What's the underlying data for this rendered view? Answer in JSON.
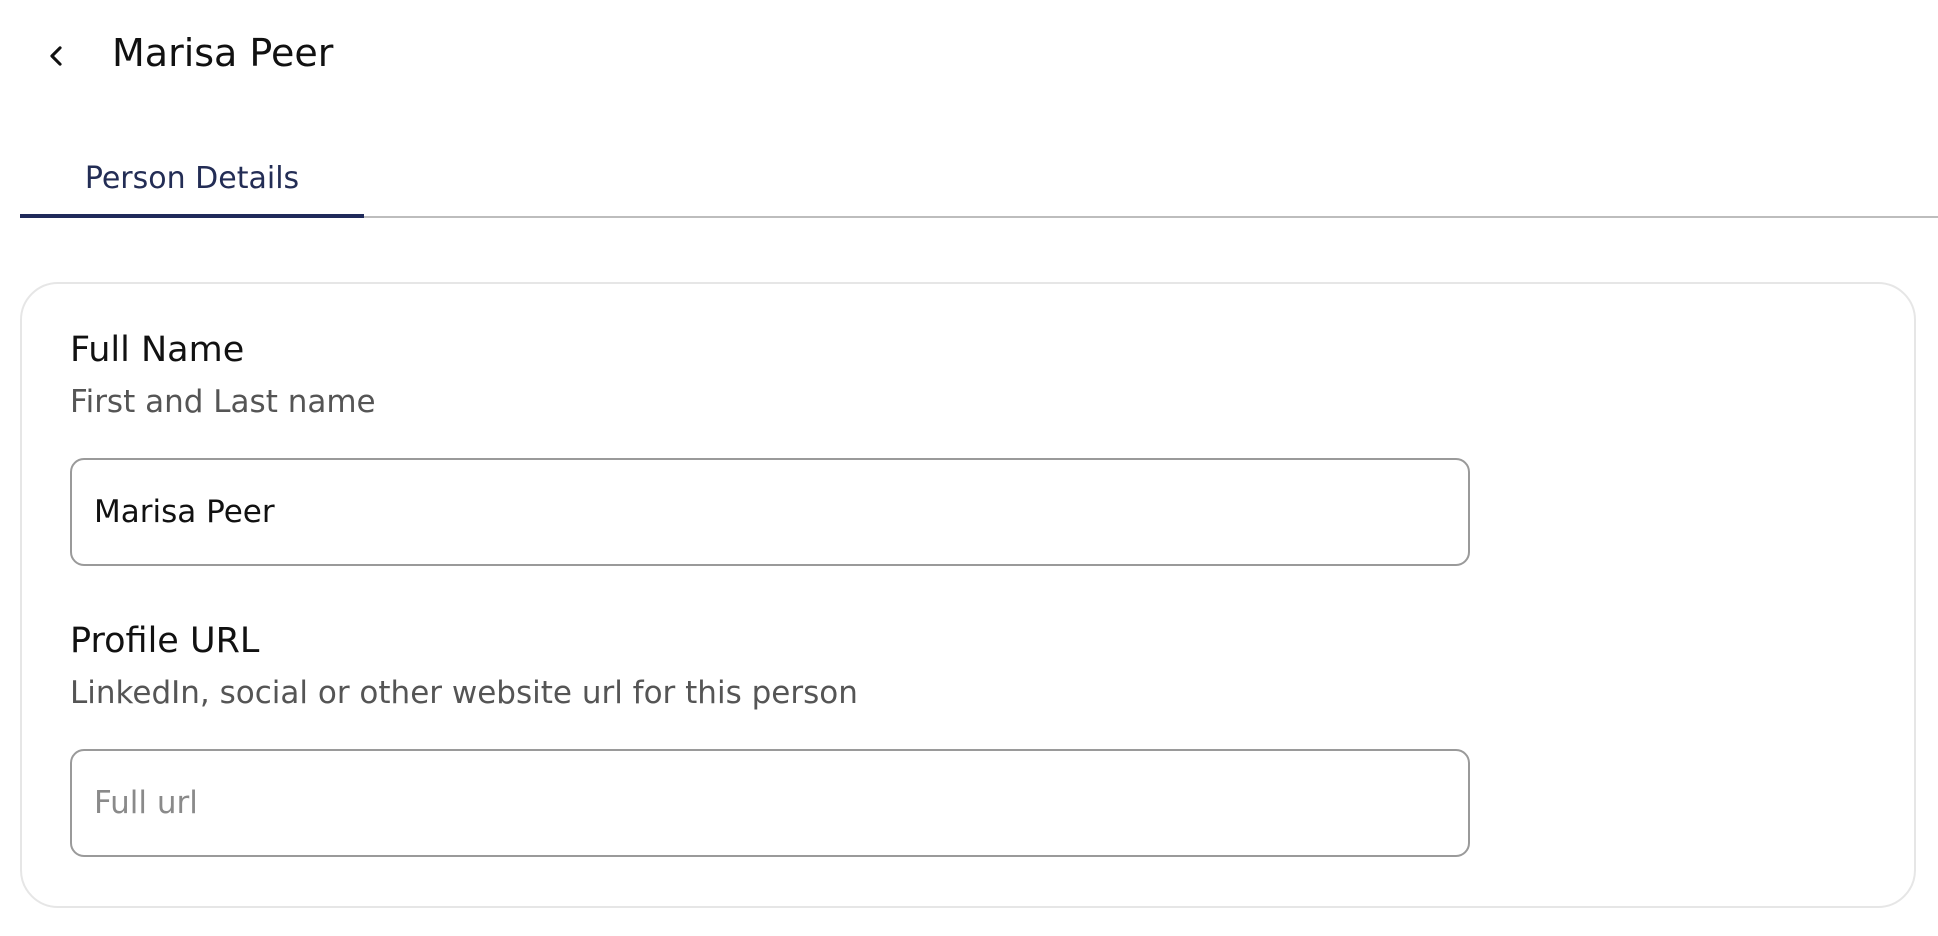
{
  "header": {
    "title": "Marisa Peer",
    "back_icon": "chevron-left-icon"
  },
  "tabs": [
    {
      "label": "Person Details",
      "active": true
    }
  ],
  "colors": {
    "accent": "#1f2a5a",
    "tab_text": "#232d55",
    "subtitle_text": "#555555",
    "border": "#9a9a9a"
  },
  "form": {
    "full_name": {
      "title": "Full Name",
      "subtitle": "First and Last name",
      "value": "Marisa Peer",
      "placeholder": ""
    },
    "profile_url": {
      "title": "Profile URL",
      "subtitle": "LinkedIn, social or other website url for this person",
      "value": "",
      "placeholder": "Full url"
    }
  }
}
